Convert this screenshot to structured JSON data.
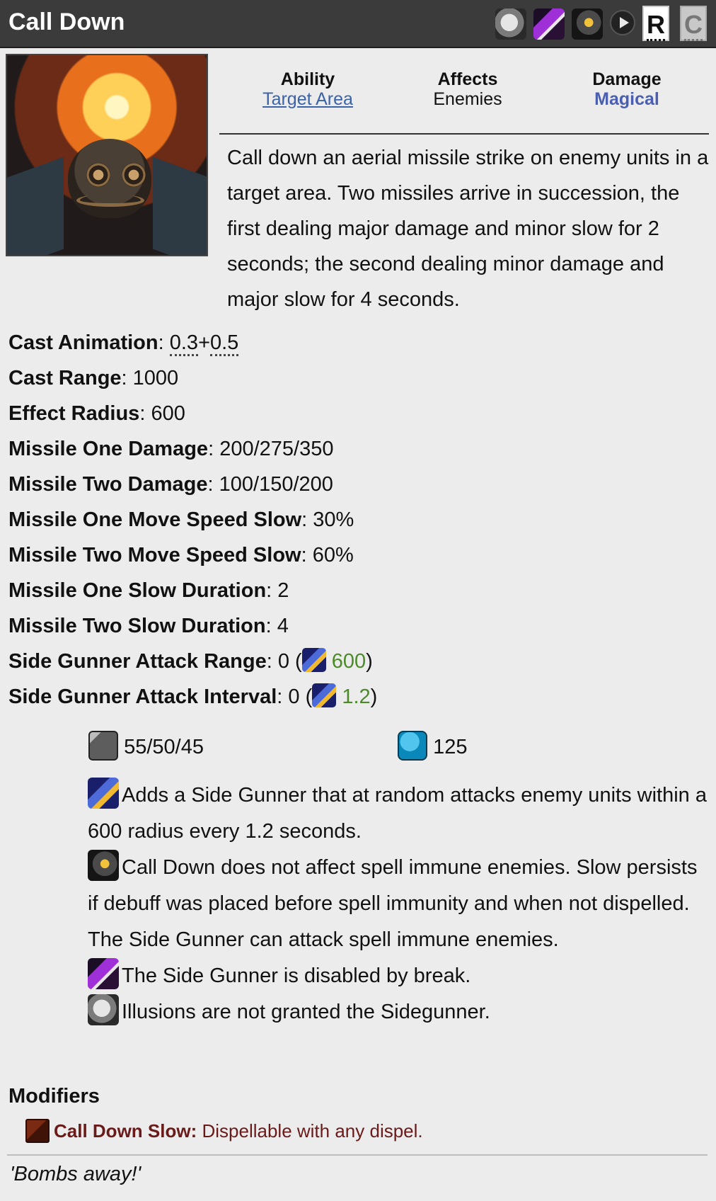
{
  "header": {
    "title": "Call Down",
    "icons": [
      "spell-immunity-icon",
      "break-icon",
      "spell-pierce-icon",
      "play-icon"
    ],
    "r_label": "R",
    "c_label": "C"
  },
  "portrait": {
    "icon": "call-down-portrait"
  },
  "meta": {
    "ability_label": "Ability",
    "ability_value": "Target Area",
    "affects_label": "Affects",
    "affects_value": "Enemies",
    "damage_label": "Damage",
    "damage_value": "Magical"
  },
  "description": "Call down an aerial missile strike on enemy units in a target area. Two missiles arrive in succession, the first dealing major damage and minor slow for 2 seconds; the second dealing minor damage and major slow for 4 seconds.",
  "stats": {
    "cast_animation_label": "Cast Animation",
    "cast_animation_a": "0.3",
    "cast_animation_b": "0.5",
    "cast_range_label": "Cast Range",
    "cast_range_value": "1000",
    "effect_radius_label": "Effect Radius",
    "effect_radius_value": "600",
    "m1_damage_label": "Missile One Damage",
    "m1_damage_value": "200/275/350",
    "m2_damage_label": "Missile Two Damage",
    "m2_damage_value": "100/150/200",
    "m1_slow_label": "Missile One Move Speed Slow",
    "m1_slow_value": "30%",
    "m2_slow_label": "Missile Two Move Speed Slow",
    "m2_slow_value": "60%",
    "m1_dur_label": "Missile One Slow Duration",
    "m1_dur_value": "2",
    "m2_dur_label": "Missile Two Slow Duration",
    "m2_dur_value": "4",
    "sg_range_label": "Side Gunner Attack Range",
    "sg_range_value": "0",
    "sg_range_aghs": "600",
    "sg_interval_label": "Side Gunner Attack Interval",
    "sg_interval_value": "0",
    "sg_interval_aghs": "1.2"
  },
  "cost": {
    "cooldown": "55/50/45",
    "mana": "125",
    "accent_mana": "#0a88b9"
  },
  "notes": {
    "aghs": "Adds a Side Gunner that at random attacks enemy units within a 600 radius every 1.2 seconds.",
    "spell_immunity": "Call Down does not affect spell immune enemies. Slow persists if debuff was placed before spell immunity and when not dispelled.",
    "side_gunner_immunity": "The Side Gunner can attack spell immune enemies.",
    "break": "The Side Gunner is disabled by break.",
    "illusions": "Illusions are not granted the Sidegunner."
  },
  "modifiers": {
    "heading": "Modifiers",
    "name": "Call Down Slow:",
    "text": "Dispellable with any dispel.",
    "color": "#6b1a1a"
  },
  "quote": "'Bombs away!'"
}
